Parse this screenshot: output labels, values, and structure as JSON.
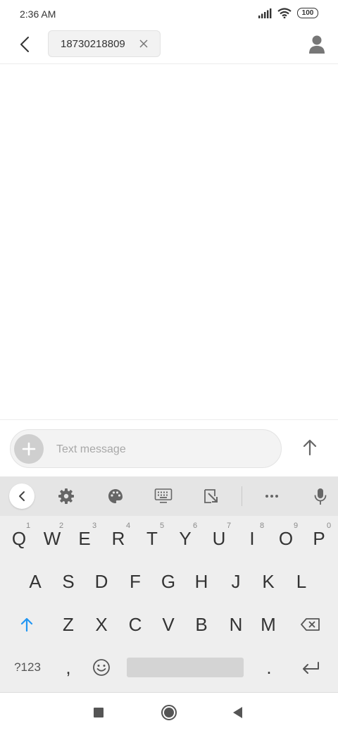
{
  "status_bar": {
    "time": "2:36 AM",
    "battery": "100",
    "icons": [
      "signal-icon",
      "wifi-icon",
      "battery-icon"
    ]
  },
  "header": {
    "recipient": "18730218809"
  },
  "compose": {
    "placeholder": "Text message"
  },
  "keyboard": {
    "toolbar_icons": [
      "chevron-left-icon",
      "gear-icon",
      "palette-icon",
      "keyboard-icon",
      "resize-icon",
      "more-icon",
      "mic-icon"
    ],
    "row1": [
      "Q",
      "W",
      "E",
      "R",
      "T",
      "Y",
      "U",
      "I",
      "O",
      "P"
    ],
    "row1_hints": [
      "1",
      "2",
      "3",
      "4",
      "5",
      "6",
      "7",
      "8",
      "9",
      "0"
    ],
    "row2": [
      "A",
      "S",
      "D",
      "F",
      "G",
      "H",
      "J",
      "K",
      "L"
    ],
    "row3": [
      "Z",
      "X",
      "C",
      "V",
      "B",
      "N",
      "M"
    ],
    "symbols_label": "?123",
    "comma": ",",
    "period": "."
  },
  "colors": {
    "shift_accent": "#2196f3",
    "keyboard_bg": "#eeeeee",
    "toolbar_bg": "#e5e5e5"
  }
}
